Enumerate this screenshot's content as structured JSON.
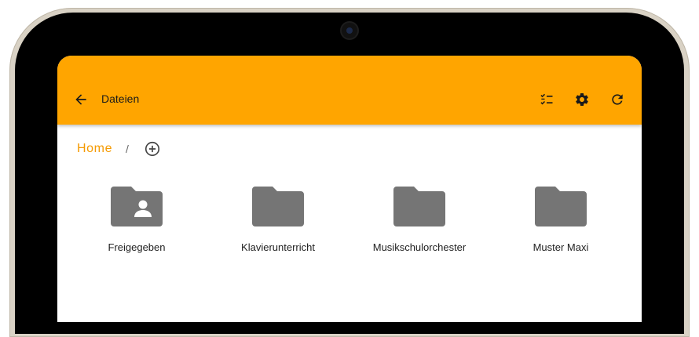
{
  "app_bar": {
    "back_icon": "arrow-back-icon",
    "title": "Dateien",
    "actions": [
      {
        "name": "checklist-button",
        "icon": "checklist-icon"
      },
      {
        "name": "settings-button",
        "icon": "gear-icon"
      },
      {
        "name": "refresh-button",
        "icon": "refresh-icon"
      }
    ],
    "color": "#ffa500"
  },
  "breadcrumb": {
    "home": "Home",
    "separator": "/",
    "add_icon": "add-circle-icon",
    "accent": "#f59a00"
  },
  "folders": [
    {
      "label": "Freigegeben",
      "icon": "shared-folder-icon"
    },
    {
      "label": "Klavierunterricht",
      "icon": "folder-icon"
    },
    {
      "label": "Musikschulorchester",
      "icon": "folder-icon"
    },
    {
      "label": "Muster Maxi",
      "icon": "folder-icon"
    }
  ],
  "folder_color": "#757575"
}
